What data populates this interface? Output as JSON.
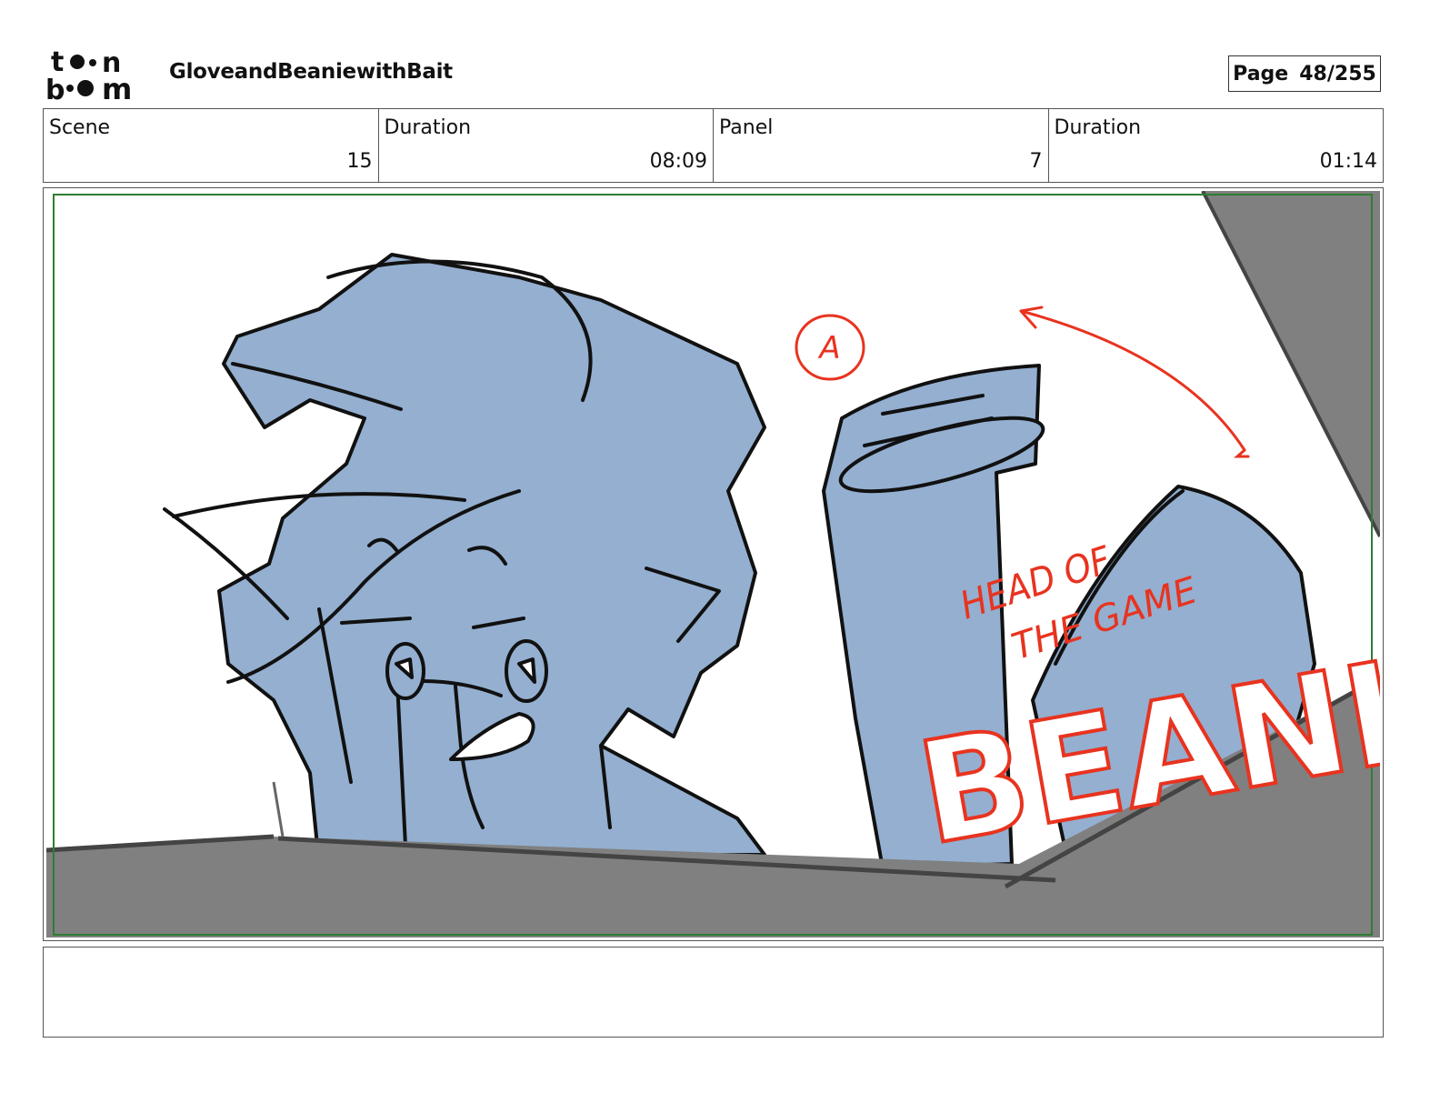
{
  "header": {
    "logo_text_top": "toon",
    "logo_text_bottom": "boom",
    "project_title": "GloveandBeaniewithBait",
    "page_label": "Page",
    "page_number": "48/255"
  },
  "info": [
    {
      "label": "Scene",
      "value": "15"
    },
    {
      "label": "Duration",
      "value": "08:09"
    },
    {
      "label": "Panel",
      "value": "7"
    },
    {
      "label": "Duration",
      "value": "01:14"
    }
  ],
  "panel": {
    "annotation_marker": "A",
    "annotation_caption": "HEAD OF THE GAME",
    "annotation_caption_line1": "HEAD OF",
    "annotation_caption_line2": "THE GAME",
    "annotation_title": "BEANIE",
    "colors": {
      "character_fill": "#94afd0",
      "line": "#111111",
      "annotation": "#e8331f",
      "ground": "#808080",
      "safe_frame": "#2e7d32"
    }
  },
  "notes": {
    "text": ""
  }
}
